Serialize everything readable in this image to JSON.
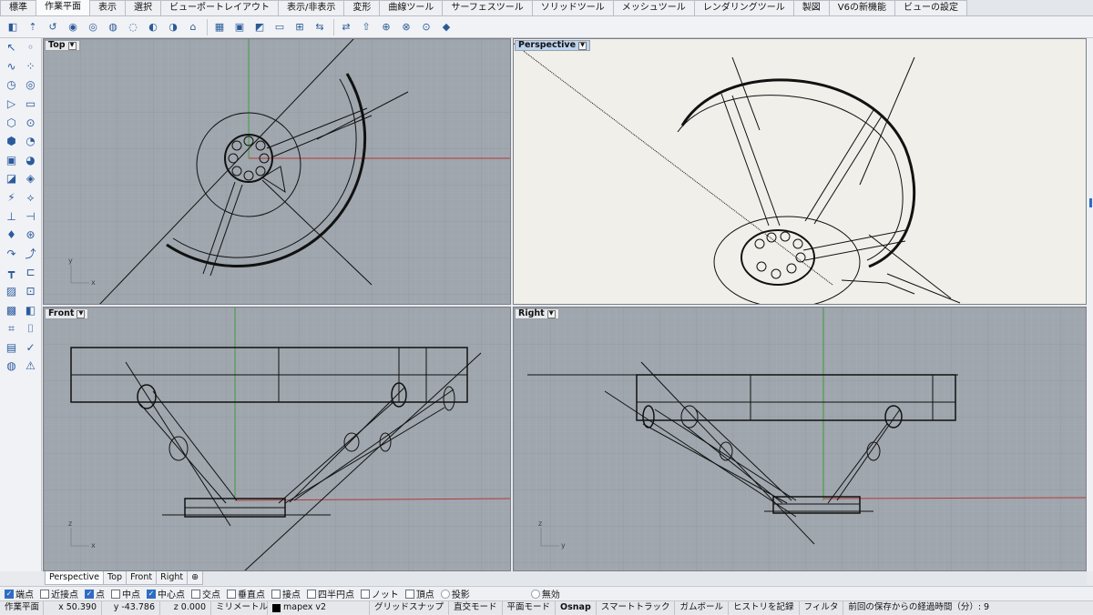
{
  "tabs": [
    "標準",
    "作業平面",
    "表示",
    "選択",
    "ビューポートレイアウト",
    "表示/非表示",
    "変形",
    "曲線ツール",
    "サーフェスツール",
    "ソリッドツール",
    "メッシュツール",
    "レンダリングツール",
    "製図",
    "V6の新機能",
    "ビューの設定"
  ],
  "active_tab": "作業平面",
  "viewports": {
    "top": {
      "title": "Top",
      "active": false
    },
    "perspective": {
      "title": "Perspective",
      "active": true
    },
    "front": {
      "title": "Front",
      "active": false
    },
    "right": {
      "title": "Right",
      "active": false
    }
  },
  "axis_labels": {
    "x": "x",
    "y": "y",
    "z": "z"
  },
  "viewport_tabs": [
    "Perspective",
    "Top",
    "Front",
    "Right"
  ],
  "add_tab_icon": "plus-icon",
  "osnap": [
    {
      "label": "端点",
      "checked": true
    },
    {
      "label": "近接点",
      "checked": false
    },
    {
      "label": "点",
      "checked": true
    },
    {
      "label": "中点",
      "checked": false
    },
    {
      "label": "中心点",
      "checked": true
    },
    {
      "label": "交点",
      "checked": false
    },
    {
      "label": "垂直点",
      "checked": false
    },
    {
      "label": "接点",
      "checked": false
    },
    {
      "label": "四半円点",
      "checked": false
    },
    {
      "label": "ノット",
      "checked": false
    },
    {
      "label": "頂点",
      "checked": false
    },
    {
      "label": "投影",
      "checked": false,
      "radio": true
    },
    {
      "label": "無効",
      "checked": false,
      "radio": true
    }
  ],
  "status": {
    "cplane": "作業平面",
    "x": "x 50.390",
    "y": "y -43.786",
    "z": "z 0.000",
    "units": "ミリメートル",
    "layer": "mapex v2",
    "grid_snap": "グリッドスナップ",
    "ortho": "直交モード",
    "planar": "平面モード",
    "osnap": "Osnap",
    "smart_track": "スマートトラック",
    "gumball": "ガムボール",
    "history": "ヒストリを記録",
    "filter": "フィルタ",
    "elapsed": "前回の保存からの経過時間（分）: 9"
  },
  "colors": {
    "grid_bg": "#9fa6ad",
    "grid_minor": "#a8aeb5",
    "grid_major": "#8c939b",
    "axis_x": "#b33a3a",
    "axis_y": "#3f9a3f",
    "perspective_bg": "#f1efe9",
    "accent": "#2f6dc2"
  }
}
